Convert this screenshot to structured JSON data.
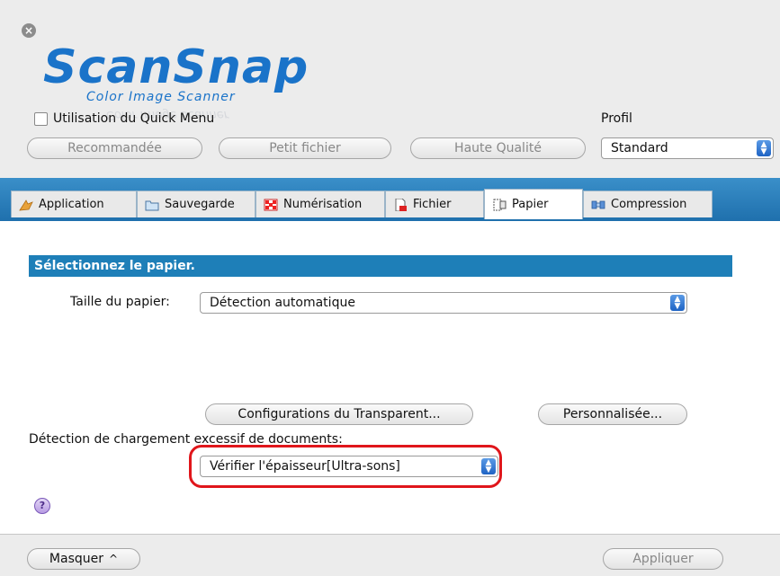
{
  "window": {
    "close_glyph": "×"
  },
  "logo": {
    "title": "ScanSnap",
    "subtitle": "Color Image Scanner",
    "ghost_text": "Color Image Scanner"
  },
  "quick_menu": {
    "checkbox_label": "Utilisation du Quick Menu",
    "checked": false
  },
  "profile": {
    "label": "Profil",
    "selected": "Standard"
  },
  "preset_buttons": [
    {
      "label": "Recommandée"
    },
    {
      "label": "Petit fichier"
    },
    {
      "label": "Haute Qualité"
    }
  ],
  "tabs": [
    {
      "label": "Application",
      "icon": "application-icon"
    },
    {
      "label": "Sauvegarde",
      "icon": "folder-icon"
    },
    {
      "label": "Numérisation",
      "icon": "scan-icon"
    },
    {
      "label": "Fichier",
      "icon": "file-icon"
    },
    {
      "label": "Papier",
      "icon": "paper-icon",
      "active": true
    },
    {
      "label": "Compression",
      "icon": "compression-icon"
    }
  ],
  "section": {
    "header": "Sélectionnez le papier."
  },
  "paper_size": {
    "label": "Taille du papier:",
    "selected": "Détection automatique"
  },
  "buttons": {
    "transparent": "Configurations du Transparent...",
    "custom": "Personnalisée..."
  },
  "overload": {
    "label": "Détection de chargement excessif de documents:",
    "selected": "Vérifier l'épaisseur[Ultra-sons]"
  },
  "help": {
    "glyph": "?"
  },
  "footer": {
    "hide_label": "Masquer",
    "hide_glyph": "^",
    "apply_label": "Appliquer"
  },
  "colors": {
    "accent": "#1e7fb8",
    "tabbar": "#2a80bd",
    "highlight": "#e0161b",
    "logo": "#1a73c9"
  }
}
